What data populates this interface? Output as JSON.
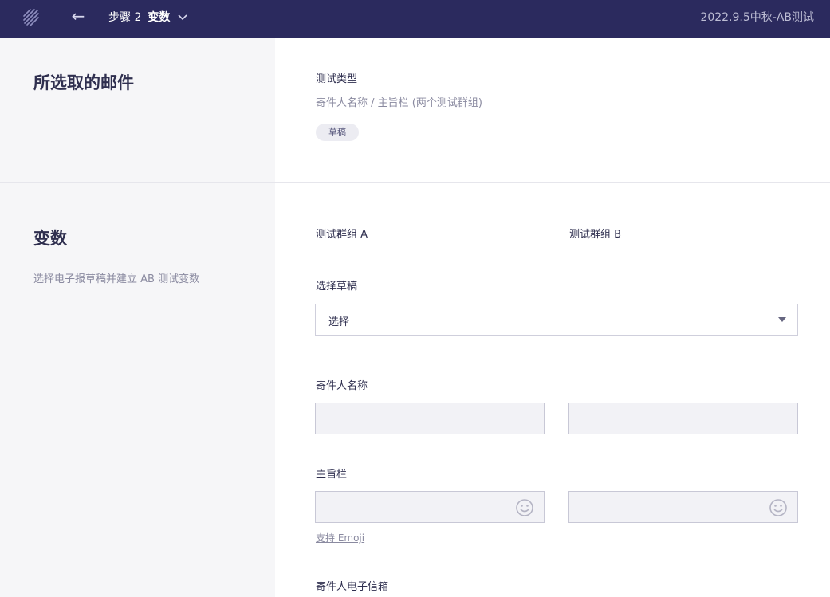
{
  "header": {
    "step_number": "步骤 2",
    "step_name": "变数",
    "campaign_title": "2022.9.5中秋-AB测试"
  },
  "selected_mail": {
    "heading": "所选取的邮件",
    "test_type_label": "测试类型",
    "test_type_value": "寄件人名称 / 主旨栏 (两个测试群组)",
    "status_badge": "草稿"
  },
  "variables": {
    "heading": "变数",
    "description": "选择电子报草稿并建立 AB 测试变数",
    "group_a_label": "测试群组 A",
    "group_b_label": "测试群组 B",
    "select_draft_label": "选择草稿",
    "select_draft_value": "选择",
    "sender_name_label": "寄件人名称",
    "subject_label": "主旨栏",
    "emoji_support_link": "支持 Emoji",
    "sender_email_label": "寄件人电子信箱"
  },
  "icons": {
    "logo": "brand-stripes-icon",
    "back": "arrow-left-icon",
    "step_dropdown": "chevron-down-icon",
    "emoji": "smiley-icon"
  },
  "colors": {
    "header_bg": "#2b2a5e",
    "left_panel_bg": "#f6f6f8",
    "input_bg": "#f2f2f6"
  }
}
